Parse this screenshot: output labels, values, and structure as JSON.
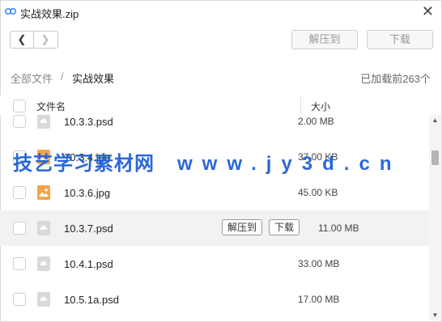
{
  "window": {
    "title": "实战效果.zip",
    "close_glyph": "✕"
  },
  "nav": {
    "back_glyph": "❮",
    "forward_glyph": "❯"
  },
  "toolbar": {
    "extract_label": "解压到",
    "download_label": "下载"
  },
  "breadcrumb": {
    "root": "全部文件",
    "separator": "/",
    "current": "实战效果"
  },
  "status": {
    "loaded_text": "已加载前263个"
  },
  "columns": {
    "name": "文件名",
    "size": "大小"
  },
  "files": [
    {
      "name": "10.3.3.psd",
      "size": "2.00 MB",
      "type": "psd"
    },
    {
      "name": "10.3.4.jpg",
      "size": "37.00 KB",
      "type": "jpg"
    },
    {
      "name": "10.3.6.jpg",
      "size": "45.00 KB",
      "type": "jpg"
    },
    {
      "name": "10.3.7.psd",
      "size": "11.00 MB",
      "type": "psd",
      "hovered": true
    },
    {
      "name": "10.4.1.psd",
      "size": "33.00 MB",
      "type": "psd"
    },
    {
      "name": "10.5.1a.psd",
      "size": "17.00 MB",
      "type": "psd"
    }
  ],
  "row_actions": {
    "extract_label": "解压到",
    "download_label": "下载"
  },
  "watermark": {
    "cn": "技艺学习素材网",
    "domain": "www.jy3d.cn"
  },
  "colors": {
    "watermark": "#1f5fd6",
    "jpg_icon": "#f5a44a",
    "psd_icon": "#d9d9d9",
    "hover_row": "#f2f2f2"
  }
}
